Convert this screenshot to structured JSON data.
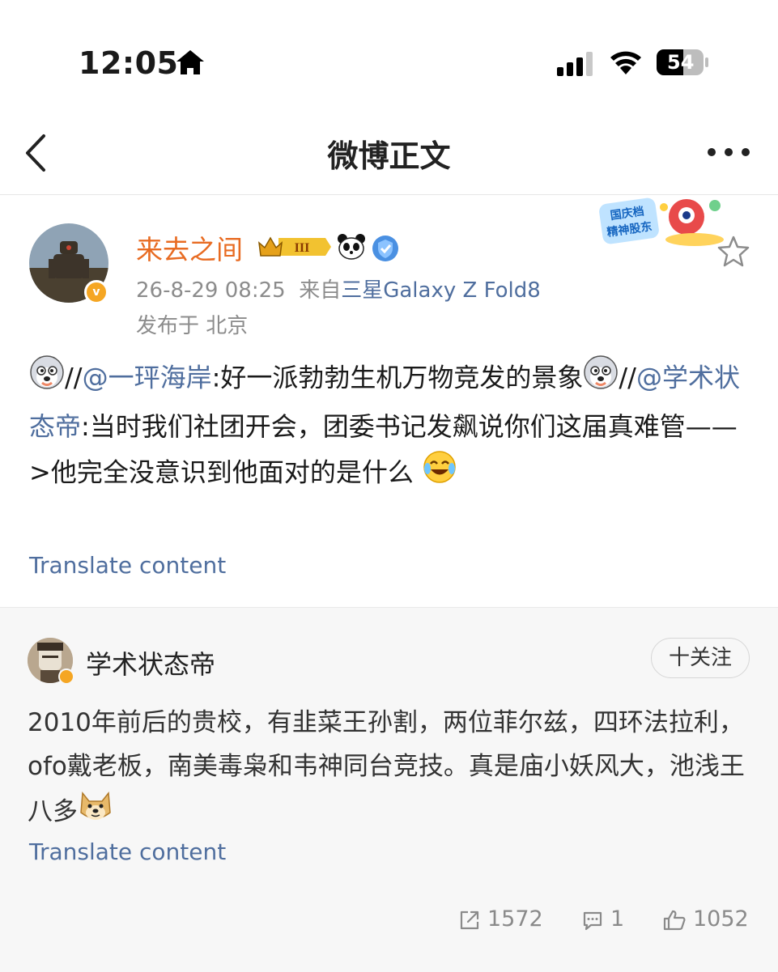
{
  "status_bar": {
    "time": "12:05",
    "battery": "54"
  },
  "nav": {
    "title": "微博正文"
  },
  "post": {
    "author": "来去之间",
    "crown_level": "III",
    "time": "26-8-29 08:25",
    "source_prefix": "来自",
    "device": "三星Galaxy Z Fold8",
    "location": "发布于 北京",
    "holiday_badge": "国庆档\n精神股东",
    "text": {
      "sep1": "//",
      "mention1": "@一玶海岸",
      "part1": ":好一派勃勃生机万物竞发的景象",
      "sep2": "//",
      "mention2": "@学术状态帝",
      "part2": ":当时我们社团开会，团委书记发飙说你们这届真难管——>他完全没意识到他面对的是什么"
    },
    "translate": "Translate content"
  },
  "repost": {
    "author": "学术状态帝",
    "follow_label": "十关注",
    "text": "2010年前后的贵校，有韭菜王孙割，两位菲尔兹，四环法拉利，ofo戴老板，南美毒枭和韦神同台竞技。真是庙小妖风大，池浅王八多",
    "translate": "Translate content",
    "stats": {
      "reposts": "1572",
      "comments": "1",
      "likes": "1052"
    }
  },
  "colors": {
    "author_name": "#e86b22",
    "link": "#4f6e9e",
    "meta": "#8c8c8c",
    "repost_bg": "#f7f7f7"
  },
  "icons": [
    "back-arrow-icon",
    "more-icon",
    "star-icon",
    "repost-icon",
    "comment-icon",
    "like-icon",
    "home-icon",
    "signal-icon",
    "wifi-icon",
    "battery-icon"
  ]
}
